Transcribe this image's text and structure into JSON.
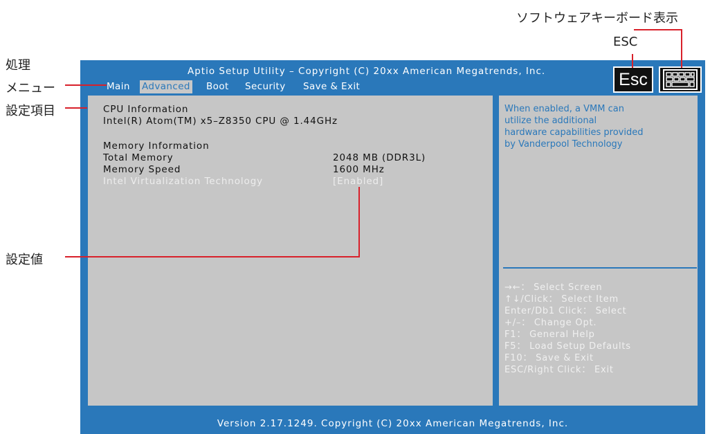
{
  "annotations": {
    "menu_label_line1": "処理",
    "menu_label_line2": "メニュー",
    "item_label": "設定項目",
    "value_label": "設定値",
    "esc_label": "ESC",
    "keyboard_label": "ソフトウェアキーボード表示"
  },
  "bios": {
    "title": "Aptio Setup Utility – Copyright (C) 20xx American Megatrends, Inc.",
    "footer": "Version 2.17.1249. Copyright (C) 20xx American Megatrends, Inc.",
    "menus": [
      "Main",
      "Advanced",
      "Boot",
      "Security",
      "Save & Exit"
    ],
    "active_menu": "Advanced",
    "esc_button": "Esc",
    "settings": {
      "cpu_header": "CPU Information",
      "cpu_model": "Intel(R) Atom(TM) x5–Z8350 CPU @ 1.44GHz",
      "memory_header": "Memory Information",
      "total_memory_label": "Total Memory",
      "total_memory_value": "2048 MB (DDR3L)",
      "memory_speed_label": "Memory Speed",
      "memory_speed_value": "1600 MHz",
      "virtualization_label": "Intel Virtualization Technology",
      "virtualization_value": "[Enabled]"
    },
    "help_text": [
      "When enabled, a VMM can",
      "utilize the additional",
      "hardware capabilities provided",
      "by Vanderpool Technology"
    ],
    "key_help": [
      "→←： Select Screen",
      "↑↓/Click： Select Item",
      "Enter/Db1 Click： Select",
      "+/–： Change Opt.",
      "F1： General Help",
      "F5： Load Setup Defaults",
      "F10： Save & Exit",
      "ESC/Right Click： Exit"
    ]
  },
  "colors": {
    "accent": "#2a78ba",
    "panel": "#c6c6c6",
    "annotation_line": "#d8202a"
  }
}
